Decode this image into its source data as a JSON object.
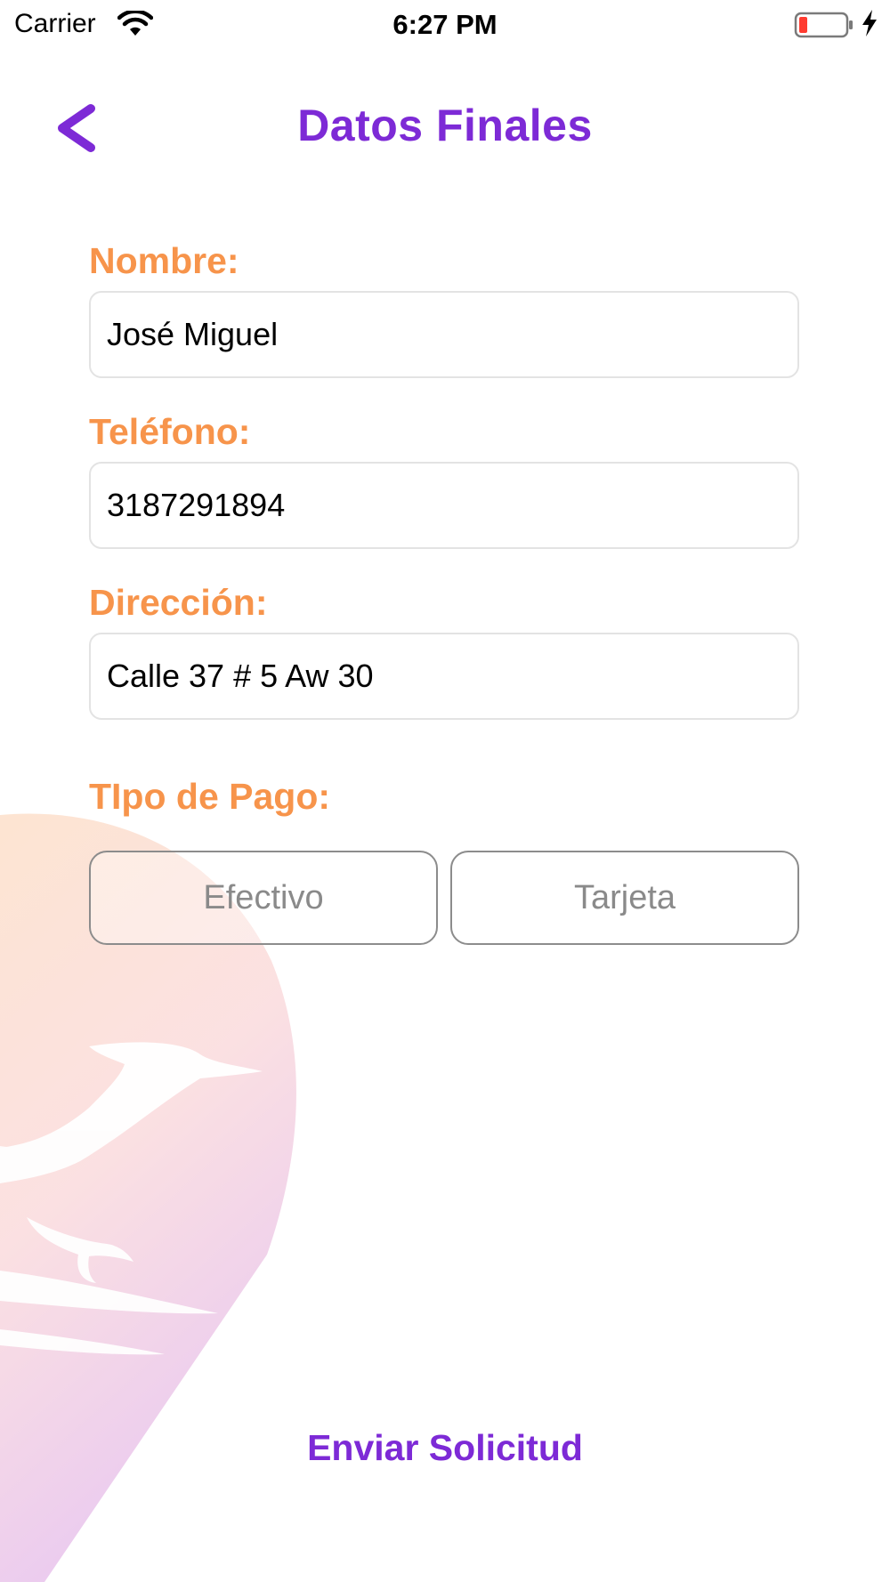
{
  "status_bar": {
    "carrier": "Carrier",
    "time": "6:27 PM"
  },
  "header": {
    "title": "Datos Finales"
  },
  "form": {
    "name_label": "Nombre:",
    "name_value": "José Miguel",
    "phone_label": "Teléfono:",
    "phone_value": "3187291894",
    "address_label": "Dirección:",
    "address_value": "Calle 37 # 5 Aw 30",
    "payment_label": "TIpo de Pago:",
    "payment_options": [
      "Efectivo",
      "Tarjeta"
    ]
  },
  "submit_label": "Enviar Solicitud",
  "colors": {
    "accent": "#7d2ad6",
    "label": "#f7944b",
    "battery_low": "#ff3b30"
  }
}
